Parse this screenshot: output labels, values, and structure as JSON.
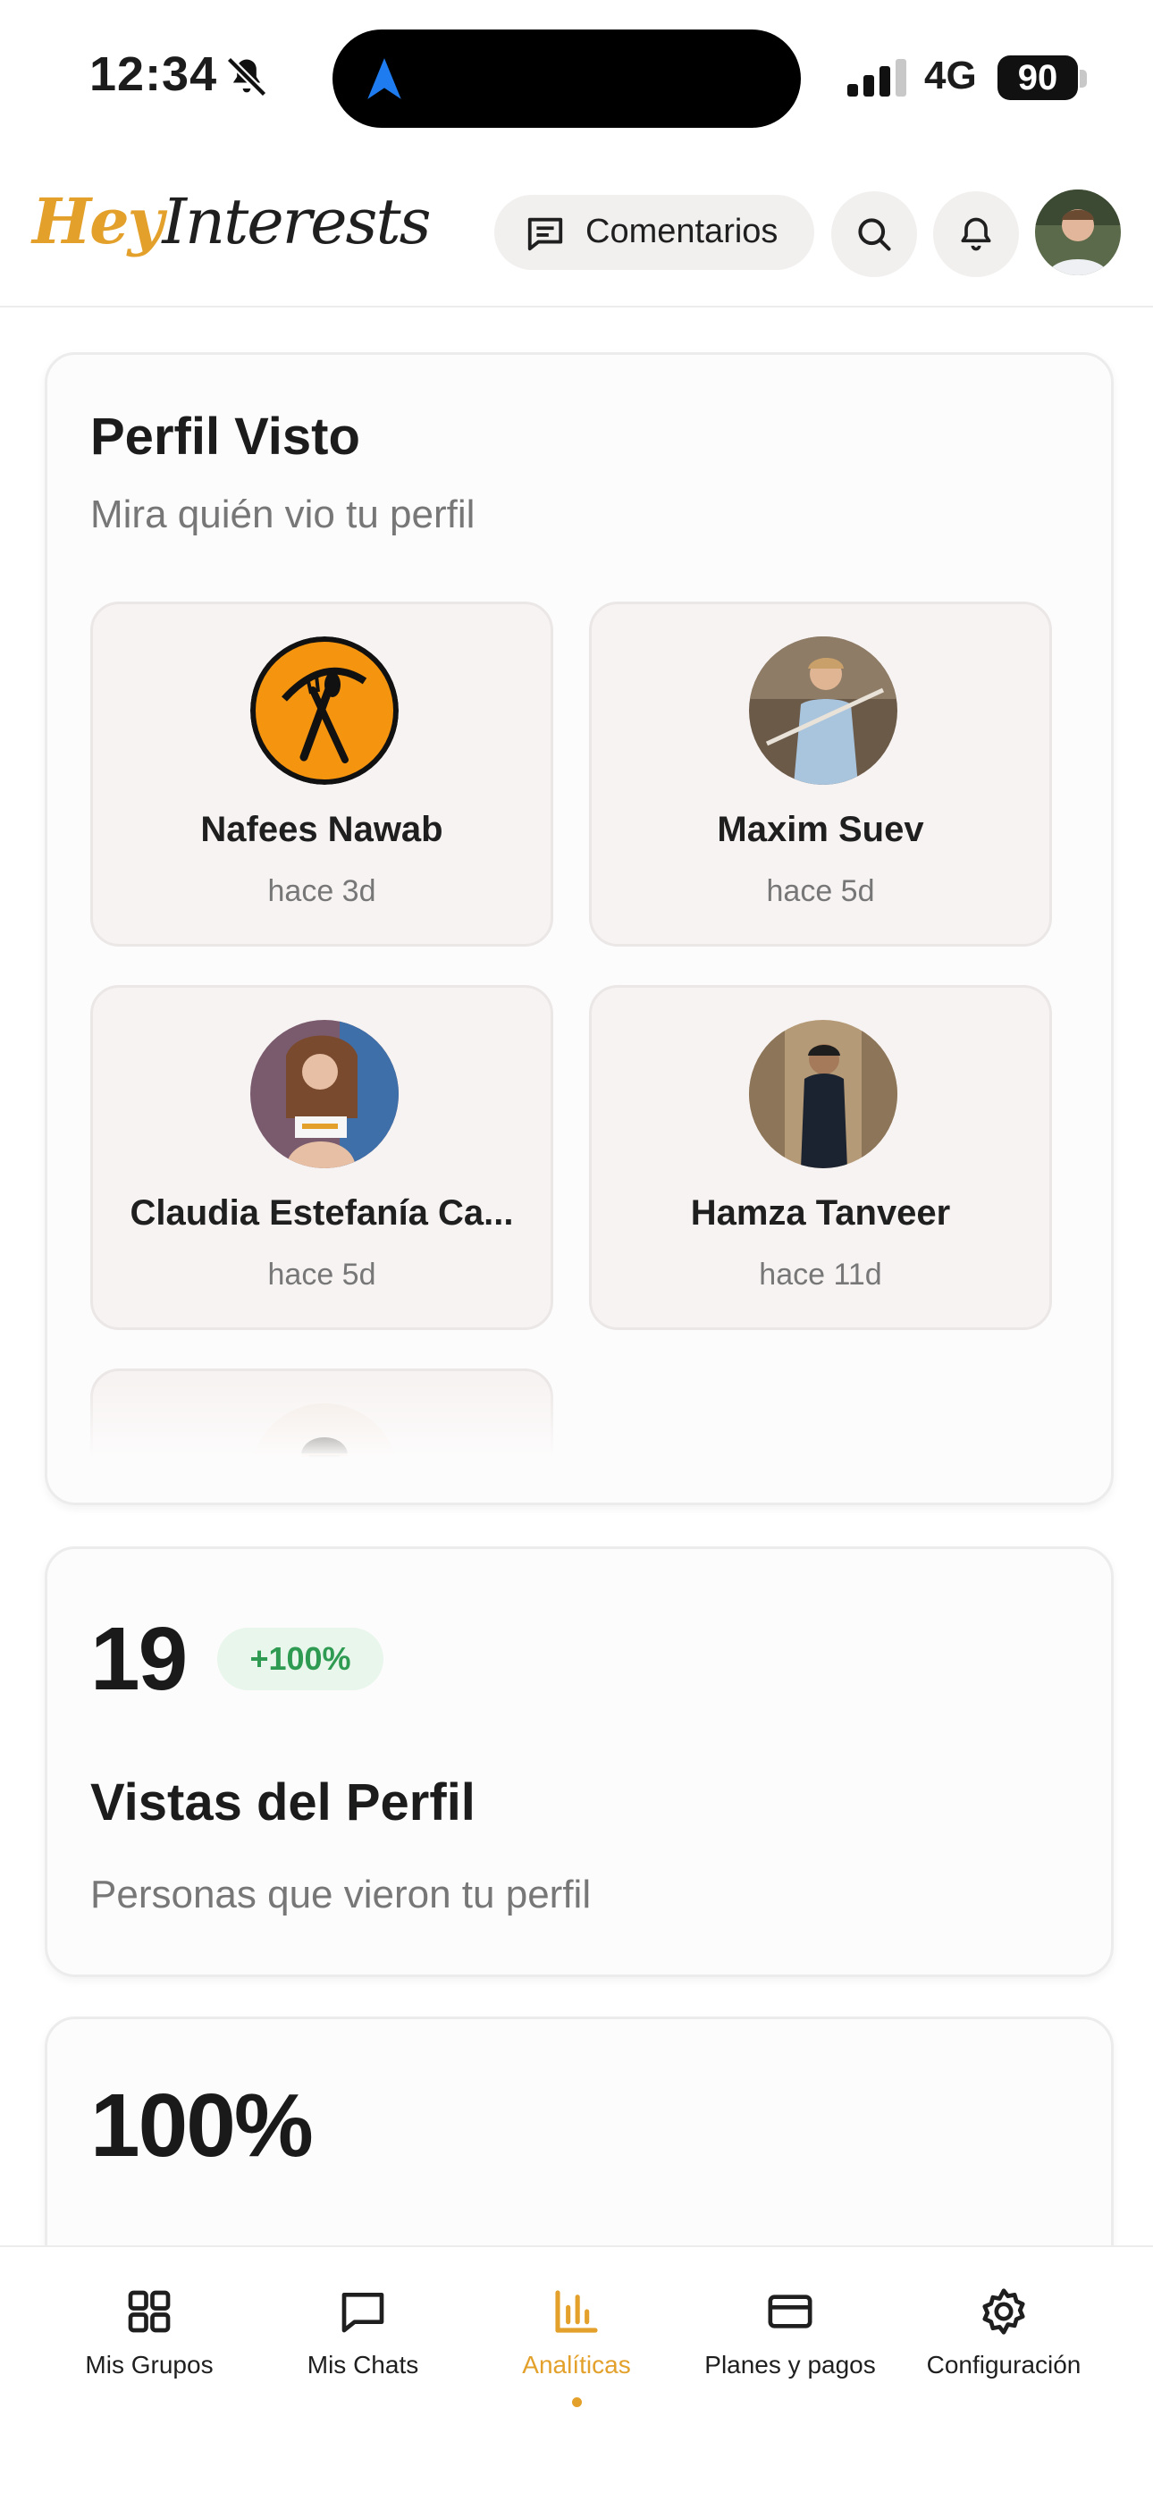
{
  "status_bar": {
    "time": "12:34",
    "network": "4G",
    "battery": "90"
  },
  "header": {
    "logo_hey": "Hey",
    "logo_rest": "Interests",
    "comments_label": "Comentarios",
    "brand_color": "#e3a12c"
  },
  "viewed_card": {
    "title": "Perfil Visto",
    "subtitle": "Mira quién vio tu perfil",
    "viewers": [
      {
        "name": "Nafees Nawab",
        "time": "hace 3d"
      },
      {
        "name": "Maxim Suev",
        "time": "hace 5d"
      },
      {
        "name": "Claudia Estefanía Ca...",
        "time": "hace 5d"
      },
      {
        "name": "Hamza Tanveer",
        "time": "hace 11d"
      }
    ]
  },
  "views_card": {
    "value": "19",
    "change": "+100%",
    "title": "Vistas del Perfil",
    "subtitle": "Personas que vieron tu perfil"
  },
  "percent_card": {
    "value": "100%"
  },
  "bottom_nav": {
    "items": [
      {
        "label": "Mis Grupos",
        "icon": "grid-icon"
      },
      {
        "label": "Mis Chats",
        "icon": "chat-icon"
      },
      {
        "label": "Analíticas",
        "icon": "bar-chart-icon",
        "active": true
      },
      {
        "label": "Planes y pagos",
        "icon": "card-icon"
      },
      {
        "label": "Configuración",
        "icon": "gear-icon"
      }
    ]
  }
}
